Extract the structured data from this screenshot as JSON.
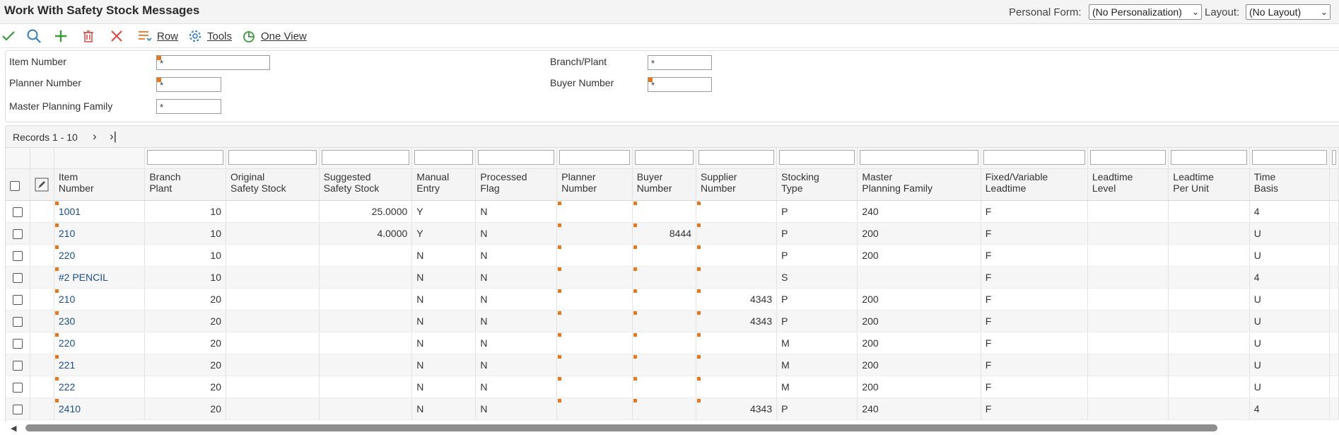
{
  "window": {
    "title": "Work With Safety Stock Messages",
    "personal_form_label": "Personal Form:",
    "personal_form_value": "(No Personalization)",
    "layout_label": "Layout:",
    "layout_value": "(No Layout)"
  },
  "toolbar": {
    "icons": [
      "checkmark-icon",
      "search-icon",
      "add-icon",
      "delete-icon",
      "close-icon",
      "row-menu-icon",
      "tools-gear-icon",
      "one-view-icon"
    ],
    "row_label": "Row",
    "tools_label": "Tools",
    "one_view_label": "One View"
  },
  "filters": {
    "item_number": {
      "label": "Item Number",
      "value": "*"
    },
    "planner_number": {
      "label": "Planner Number",
      "value": "*"
    },
    "master_planning_family": {
      "label": "Master Planning Family",
      "value": "*"
    },
    "branch_plant": {
      "label": "Branch/Plant",
      "value": "*"
    },
    "buyer_number": {
      "label": "Buyer Number",
      "value": "*"
    }
  },
  "grid": {
    "records_label": "Records 1 - 10",
    "columns": [
      {
        "line1": "Item",
        "line2": "Number"
      },
      {
        "line1": "Branch",
        "line2": "Plant"
      },
      {
        "line1": "Original",
        "line2": "Safety Stock"
      },
      {
        "line1": "Suggested",
        "line2": "Safety Stock"
      },
      {
        "line1": "Manual",
        "line2": "Entry"
      },
      {
        "line1": "Processed",
        "line2": "Flag"
      },
      {
        "line1": "Planner",
        "line2": "Number"
      },
      {
        "line1": "Buyer",
        "line2": "Number"
      },
      {
        "line1": "Supplier",
        "line2": "Number"
      },
      {
        "line1": "Stocking",
        "line2": "Type"
      },
      {
        "line1": "Master",
        "line2": "Planning Family"
      },
      {
        "line1": "Fixed/Variable",
        "line2": "Leadtime"
      },
      {
        "line1": "Leadtime",
        "line2": "Level"
      },
      {
        "line1": "Leadtime",
        "line2": "Per Unit"
      },
      {
        "line1": "Time",
        "line2": "Basis"
      }
    ],
    "rows": [
      [
        "1001",
        "10",
        "",
        "25.0000",
        "Y",
        "N",
        "",
        "",
        "",
        "P",
        "240",
        "F",
        "",
        "",
        "4"
      ],
      [
        "210",
        "10",
        "",
        "4.0000",
        "Y",
        "N",
        "",
        "8444",
        "",
        "P",
        "200",
        "F",
        "",
        "",
        "U"
      ],
      [
        "220",
        "10",
        "",
        "",
        "N",
        "N",
        "",
        "",
        "",
        "P",
        "200",
        "F",
        "",
        "",
        "U"
      ],
      [
        "#2 PENCIL",
        "10",
        "",
        "",
        "N",
        "N",
        "",
        "",
        "",
        "S",
        "",
        "F",
        "",
        "",
        "4"
      ],
      [
        "210",
        "20",
        "",
        "",
        "N",
        "N",
        "",
        "",
        "4343",
        "P",
        "200",
        "F",
        "",
        "",
        "U"
      ],
      [
        "230",
        "20",
        "",
        "",
        "N",
        "N",
        "",
        "",
        "4343",
        "P",
        "200",
        "F",
        "",
        "",
        "U"
      ],
      [
        "220",
        "20",
        "",
        "",
        "N",
        "N",
        "",
        "",
        "",
        "M",
        "200",
        "F",
        "",
        "",
        "U"
      ],
      [
        "221",
        "20",
        "",
        "",
        "N",
        "N",
        "",
        "",
        "",
        "M",
        "200",
        "F",
        "",
        "",
        "U"
      ],
      [
        "222",
        "20",
        "",
        "",
        "N",
        "N",
        "",
        "",
        "",
        "M",
        "200",
        "F",
        "",
        "",
        "U"
      ],
      [
        "2410",
        "20",
        "",
        "",
        "N",
        "N",
        "",
        "",
        "4343",
        "P",
        "240",
        "F",
        "",
        "",
        "4"
      ]
    ]
  },
  "colors": {
    "accent_required": "#e8761c",
    "link": "#1a4f8a",
    "check_green": "#3a9a3a",
    "delete_red": "#d9463f"
  }
}
